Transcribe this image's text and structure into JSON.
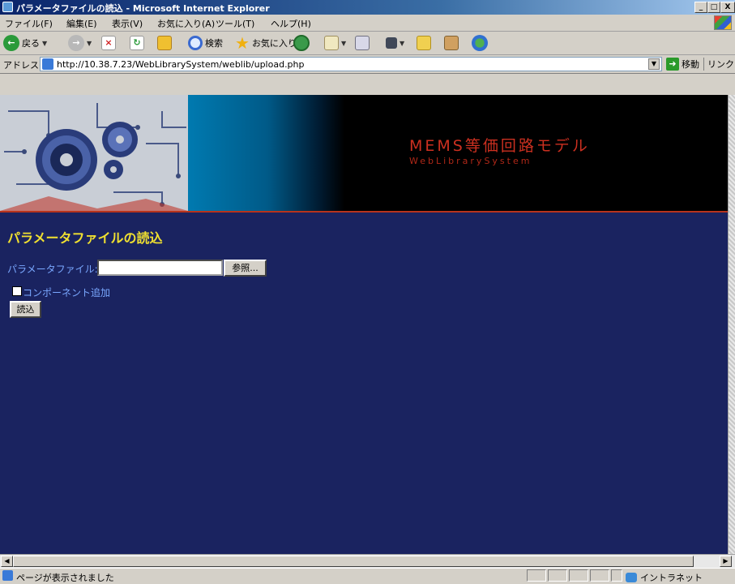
{
  "window": {
    "title": "パラメータファイルの読込 - Microsoft Internet Explorer",
    "buttons": {
      "minimize": "_",
      "maximize": "□",
      "close": "X"
    }
  },
  "menu": [
    "ファイル(F)",
    "編集(E)",
    "表示(V)",
    "お気に入り(A)",
    "ツール(T)",
    "ヘルプ(H)"
  ],
  "toolbar": {
    "back_label": "戻る",
    "search_label": "検索",
    "favorites_label": "お気に入り"
  },
  "addressbar": {
    "label": "アドレス(D)",
    "url": "http://10.38.7.23/WebLibrarySystem/weblib/upload.php",
    "go_label": "移動",
    "links_label": "リンク"
  },
  "page": {
    "banner_title": "MEMS等価回路モデル",
    "banner_subtitle": "WebLibrarySystem",
    "heading": "パラメータファイルの読込",
    "file_label": "パラメータファイル:",
    "file_value": "",
    "browse_label": "参照...",
    "checkbox_label": "コンポーネント追加",
    "checkbox_checked": false,
    "submit_label": "読込"
  },
  "statusbar": {
    "text": "ページが表示されました",
    "zone": "イントラネット"
  },
  "colors": {
    "content_bg": "#1a2360",
    "heading": "#f0e030",
    "label": "#7aa8ff",
    "banner_text": "#cc3020"
  }
}
